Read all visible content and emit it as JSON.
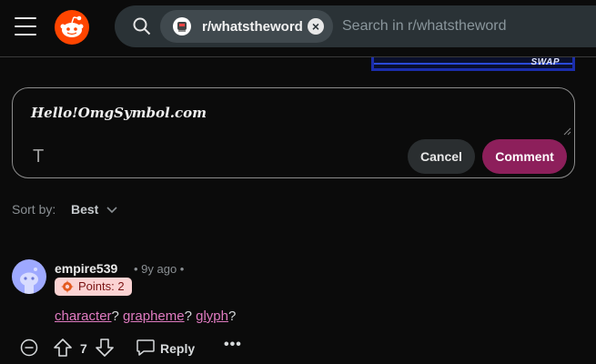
{
  "header": {
    "subreddit_chip": "r/whatstheword",
    "search_placeholder": "Search in r/whatstheword"
  },
  "thumbnail": {
    "text": "SWAP"
  },
  "composer": {
    "text": "Hello!OmgSymbol.com",
    "format_icon_label": "T",
    "cancel_label": "Cancel",
    "comment_label": "Comment"
  },
  "sort": {
    "label": "Sort by:",
    "value": "Best"
  },
  "comment": {
    "username": "empire539",
    "age": "• 9y ago •",
    "badge": "Points: 2",
    "body": [
      {
        "text": "character",
        "link": true
      },
      {
        "text": "? ",
        "link": false
      },
      {
        "text": "grapheme",
        "link": true
      },
      {
        "text": "? ",
        "link": false
      },
      {
        "text": "glyph",
        "link": true
      },
      {
        "text": "?",
        "link": false
      }
    ],
    "votes": "7",
    "reply_label": "Reply",
    "more_label": "•••"
  },
  "colors": {
    "brand": "#ff4500",
    "comment_button": "#8d1f5b",
    "link": "#e07bc1",
    "badge_bg": "#fbd3d3"
  },
  "icons": [
    "menu-icon",
    "reddit-logo-icon",
    "search-icon",
    "close-icon",
    "format-text-icon",
    "resize-handle-icon",
    "chevron-down-icon",
    "collapse-icon",
    "upvote-icon",
    "downvote-icon",
    "reply-icon",
    "more-icon",
    "award-icon"
  ]
}
